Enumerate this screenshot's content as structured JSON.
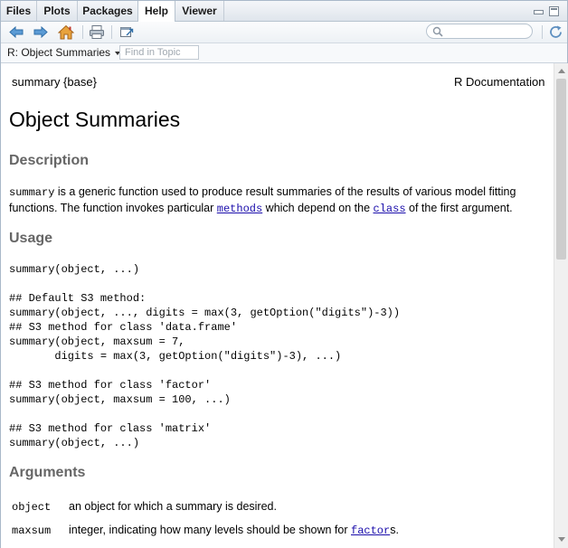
{
  "tabs": [
    {
      "label": "Files"
    },
    {
      "label": "Plots"
    },
    {
      "label": "Packages"
    },
    {
      "label": "Help"
    },
    {
      "label": "Viewer"
    }
  ],
  "active_tab": "Help",
  "colors": {
    "link": "#1a0dab",
    "section_heading": "#666666",
    "pane_border": "#a9b8c9"
  },
  "toolbar": {
    "icons": [
      "back-arrow-icon",
      "forward-arrow-icon",
      "home-icon",
      "print-icon",
      "show-in-window-icon",
      "refresh-icon"
    ],
    "search_placeholder": ""
  },
  "topic": {
    "selected": "R: Object Summaries",
    "find_placeholder": "Find in Topic"
  },
  "doc": {
    "header_left": "summary {base}",
    "header_right": "R Documentation",
    "title": "Object Summaries",
    "description_heading": "Description",
    "description": {
      "fn": "summary",
      "text1": " is a generic function used to produce result summaries of the results of various model fitting functions. The function invokes particular ",
      "link1": "methods",
      "text2": " which depend on the ",
      "link2": "class",
      "text3": " of the first argument."
    },
    "usage_heading": "Usage",
    "usage_code": "summary(object, ...)\n\n## Default S3 method:\nsummary(object, ..., digits = max(3, getOption(\"digits\")-3))\n## S3 method for class 'data.frame'\nsummary(object, maxsum = 7,\n       digits = max(3, getOption(\"digits\")-3), ...)\n\n## S3 method for class 'factor'\nsummary(object, maxsum = 100, ...)\n\n## S3 method for class 'matrix'\nsummary(object, ...)",
    "arguments_heading": "Arguments",
    "arguments": [
      {
        "name": "object",
        "desc": "an object for which a summary is desired.",
        "link": "",
        "suffix": ""
      },
      {
        "name": "maxsum",
        "desc": "integer, indicating how many levels should be shown for ",
        "link": "factor",
        "suffix": "s."
      }
    ]
  }
}
